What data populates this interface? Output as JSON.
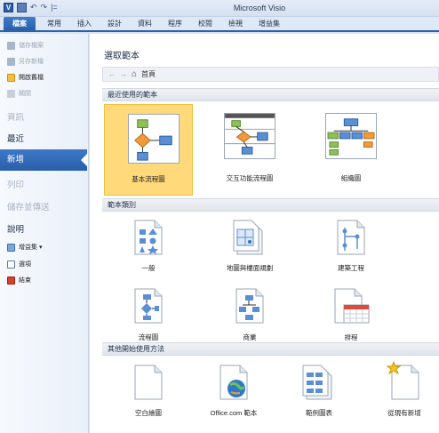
{
  "window": {
    "title": "Microsoft Visio",
    "qat_app_icon": "V",
    "qat_undo_glyph": "↶",
    "qat_redo_glyph": "↷",
    "qat_sep": "|="
  },
  "tabs": [
    "檔案",
    "常用",
    "插入",
    "設計",
    "資料",
    "程序",
    "校閱",
    "檢視",
    "增益集"
  ],
  "leftnav": {
    "commands_top": [
      {
        "label": "儲存檔案",
        "icon": "save-icon",
        "disabled": true
      },
      {
        "label": "另存新檔",
        "icon": "save-as-icon",
        "disabled": true
      },
      {
        "label": "開啟舊檔",
        "icon": "open-folder-icon",
        "disabled": false
      },
      {
        "label": "關閉",
        "icon": "close-doc-icon",
        "disabled": true
      }
    ],
    "sections": [
      {
        "label": "資訊",
        "state": "disabled"
      },
      {
        "label": "最近",
        "state": "normal"
      },
      {
        "label": "新增",
        "state": "active"
      },
      {
        "label": "列印",
        "state": "disabled"
      },
      {
        "label": "儲存並傳送",
        "state": "disabled"
      },
      {
        "label": "說明",
        "state": "normal"
      }
    ],
    "commands_bottom": [
      {
        "label": "增益集 ▾",
        "icon": "addins-icon"
      },
      {
        "label": "選項",
        "icon": "options-icon"
      },
      {
        "label": "結束",
        "icon": "exit-icon"
      }
    ]
  },
  "main": {
    "heading": "選取範本",
    "breadcrumb": {
      "back": "←",
      "forward": "→",
      "home_label": "首頁"
    },
    "recent_section": "最近使用的範本",
    "recent_templates": [
      "基本流程圖",
      "交互功能流程圖",
      "組織圖"
    ],
    "category_section": "範本類別",
    "categories": [
      "一般",
      "地圖與樓面規劃",
      "建築工程",
      "流程圖",
      "商業",
      "排程"
    ],
    "other_section": "其他開始使用方法",
    "other_options": [
      "空白繪圖",
      "Office.com 範本",
      "範例圖表",
      "從現有新增"
    ]
  },
  "colors": {
    "accent": "#2a5ea8",
    "selected": "#ffd97a"
  }
}
